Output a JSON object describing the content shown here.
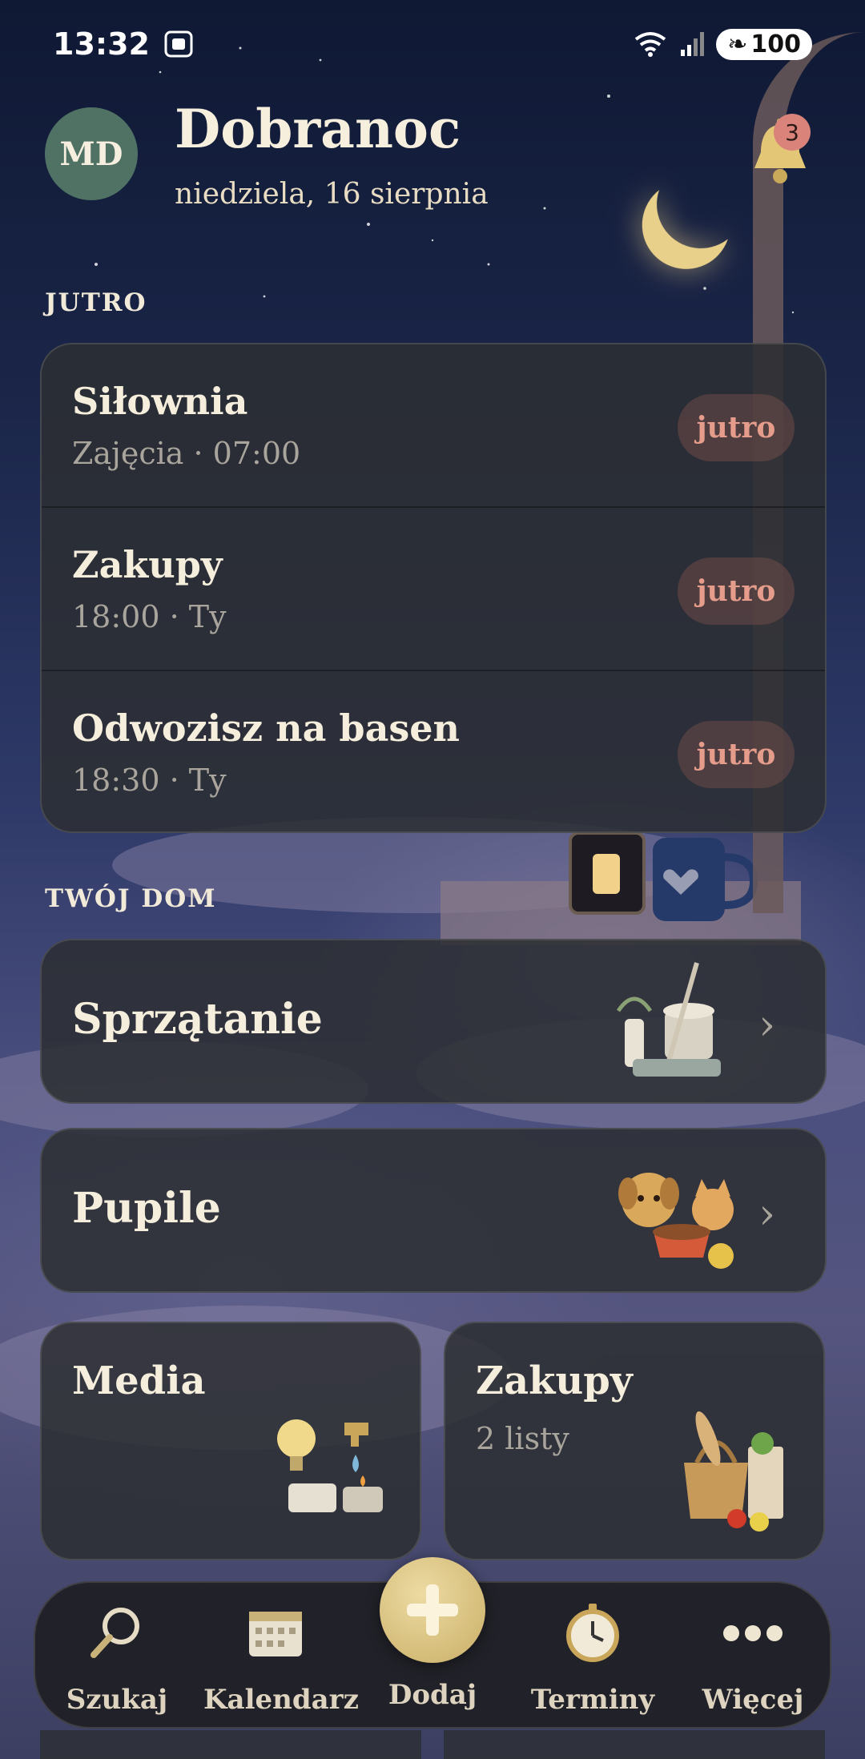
{
  "status_bar": {
    "time": "13:32",
    "battery": "100"
  },
  "header": {
    "avatar_initials": "MD",
    "greeting": "Dobranoc",
    "date": "niedziela, 16 sierpnia",
    "notifications_count": "3"
  },
  "tomorrow_section": {
    "title": "JUTRO",
    "items": [
      {
        "title": "Siłownia",
        "subtitle": "Zajęcia · 07:00",
        "badge": "jutro"
      },
      {
        "title": "Zakupy",
        "subtitle": "18:00 · Ty",
        "badge": "jutro"
      },
      {
        "title": "Odwozisz na basen",
        "subtitle": "18:30 · Ty",
        "badge": "jutro"
      }
    ]
  },
  "home_section": {
    "title": "TWÓJ DOM",
    "cleaning": {
      "label": "Sprzątanie",
      "icon": "cleaning-supplies-icon"
    },
    "pets": {
      "label": "Pupile",
      "icon": "pets-icon"
    },
    "utilities": {
      "label": "Media",
      "icon": "utilities-icon"
    },
    "shopping": {
      "label": "Zakupy",
      "subtitle": "2 listy",
      "icon": "groceries-icon"
    }
  },
  "bottom_nav": {
    "search": "Szukaj",
    "calendar": "Kalendarz",
    "add": "Dodaj",
    "deadlines": "Terminy",
    "more": "Więcej"
  },
  "colors": {
    "accent_gold": "#d8bf7a",
    "badge_text": "#e59c8a",
    "avatar": "#4f7265",
    "card": "#2c2e32"
  }
}
